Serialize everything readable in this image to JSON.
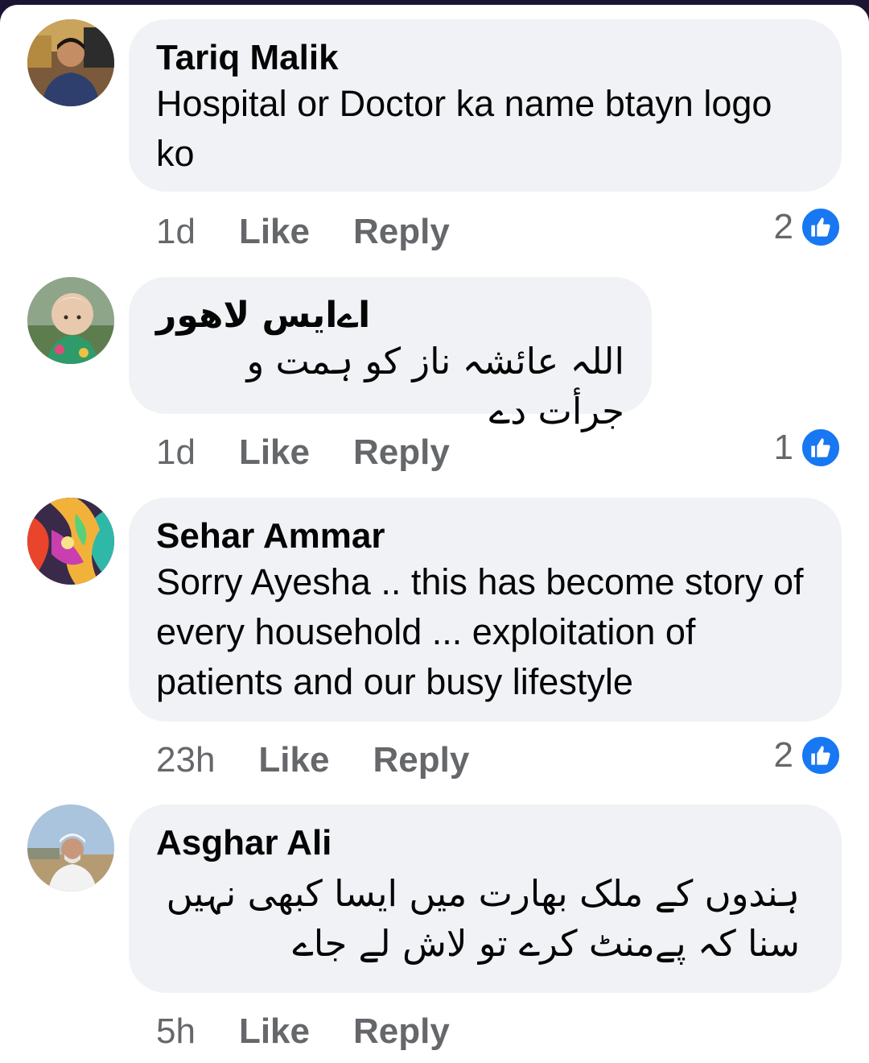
{
  "comments": [
    {
      "name": "Tariq Malik",
      "text": "Hospital or Doctor ka name btayn logo ko",
      "time": "1d",
      "like_label": "Like",
      "reply_label": "Reply",
      "reaction_count": "2",
      "reaction_icon": "like-icon"
    },
    {
      "name": "اےایس لاھور",
      "text": "اللہ عائشہ ناز کو ہمت و جرأت دے",
      "time": "1d",
      "like_label": "Like",
      "reply_label": "Reply",
      "reaction_count": "1",
      "reaction_icon": "like-icon"
    },
    {
      "name": "Sehar Ammar",
      "text": "Sorry Ayesha .. this has become story of every household ... exploitation of patients and our busy lifestyle",
      "time": "23h",
      "like_label": "Like",
      "reply_label": "Reply",
      "reaction_count": "2",
      "reaction_icon": "like-icon"
    },
    {
      "name": "Asghar Ali",
      "text": "ہندوں کے ملک بھارت میں ایسا کبھی نہیں سنا کہ پےمنٹ کرے تو لاش لے جاے",
      "time": "5h",
      "like_label": "Like",
      "reply_label": "Reply"
    }
  ],
  "colors": {
    "bubble": "#f0f2f5",
    "meta": "#65676b",
    "like_blue": "#1877f2"
  }
}
